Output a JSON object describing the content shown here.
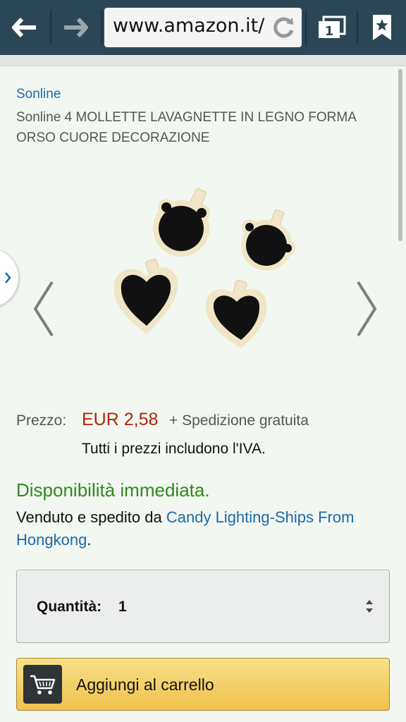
{
  "browser": {
    "url": "www.amazon.it/",
    "tab_count": "1"
  },
  "product": {
    "brand": "Sonline",
    "title": "Sonline 4 MOLLETTE LAVAGNETTE IN LEGNO FORMA ORSO CUORE DECORAZIONE"
  },
  "pricing": {
    "label": "Prezzo:",
    "price": "EUR 2,58",
    "shipping": "+ Spedizione gratuita",
    "vat_note": "Tutti i prezzi includono l'IVA."
  },
  "availability": {
    "status": "Disponibilità immediata.",
    "sold_by_prefix": "Venduto e spedito da ",
    "seller": "Candy Lighting-Ships From Hongkong",
    "suffix": "."
  },
  "quantity": {
    "label": "Quantità:",
    "value": "1"
  },
  "cart": {
    "label": "Aggiungi al carrello"
  },
  "colors": {
    "toolbar": "#2b4756",
    "link": "#1a6aa8",
    "price": "#b12704",
    "availability": "#2d8a1d",
    "cart_button": "#f0c14b"
  },
  "icons": {
    "back": "arrow-left-icon",
    "forward": "arrow-right-icon",
    "refresh": "refresh-icon",
    "tabs": "tabs-icon",
    "bookmark": "bookmark-star-icon",
    "cart": "shopping-cart-icon"
  }
}
